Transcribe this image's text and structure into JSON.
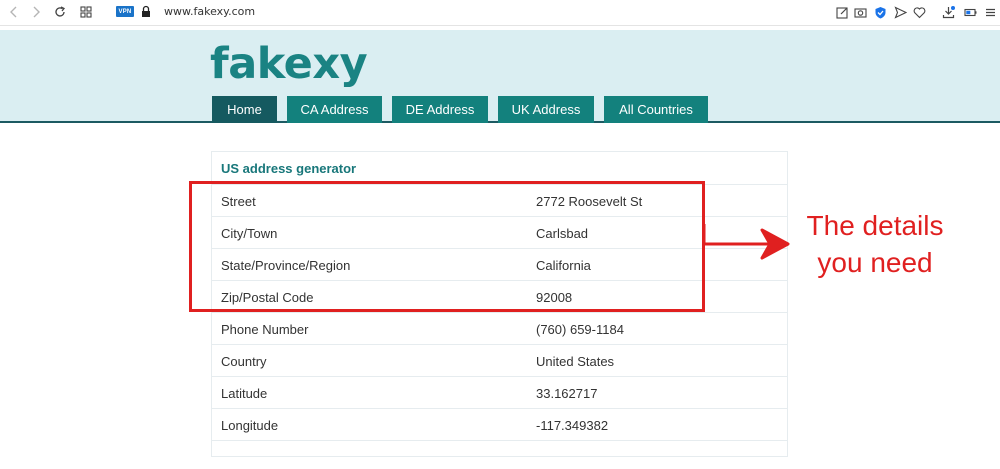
{
  "browser": {
    "vpn_label": "VPN",
    "url": "www.fakexy.com"
  },
  "site": {
    "logo": "fakexy",
    "nav": [
      {
        "label": "Home",
        "active": true
      },
      {
        "label": "CA Address",
        "active": false
      },
      {
        "label": "DE Address",
        "active": false
      },
      {
        "label": "UK Address",
        "active": false
      },
      {
        "label": "All Countries",
        "active": false
      }
    ]
  },
  "address_table": {
    "title": "US address generator",
    "rows": [
      {
        "label": "Street",
        "value": "2772 Roosevelt St"
      },
      {
        "label": "City/Town",
        "value": "Carlsbad"
      },
      {
        "label": "State/Province/Region",
        "value": "California"
      },
      {
        "label": "Zip/Postal Code",
        "value": "92008"
      },
      {
        "label": "Phone Number",
        "value": "(760) 659-1184"
      },
      {
        "label": "Country",
        "value": "United States"
      },
      {
        "label": "Latitude",
        "value": "33.162717"
      },
      {
        "label": "Longitude",
        "value": "-117.349382"
      }
    ]
  },
  "annotation": {
    "line1": "The details",
    "line2": "you need",
    "color": "#e02020"
  },
  "colors": {
    "brand": "#1a8383",
    "header_bg": "#daeef2",
    "nav_tab": "#13817d",
    "nav_tab_active": "#155a60"
  },
  "icons": [
    "back-arrow-icon",
    "forward-arrow-icon",
    "refresh-icon",
    "grid-icon",
    "lock-icon",
    "edit-icon",
    "camera-icon",
    "shield-icon",
    "send-icon",
    "heart-icon",
    "download-icon",
    "battery-icon",
    "menu-icon"
  ]
}
